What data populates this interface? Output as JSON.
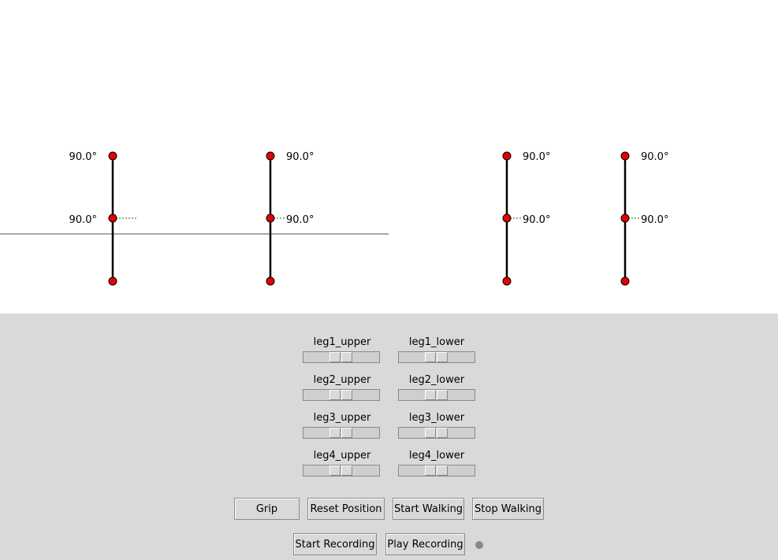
{
  "canvas": {
    "colors": {
      "joint": "#e60000",
      "leg": "#000000",
      "ground": "#555555",
      "marker": "#008000"
    },
    "legs": [
      {
        "upper_angle": "90.0°",
        "lower_angle": "90.0°"
      },
      {
        "upper_angle": "90.0°",
        "lower_angle": "90.0°"
      },
      {
        "upper_angle": "90.0°",
        "lower_angle": "90.0°"
      },
      {
        "upper_angle": "90.0°",
        "lower_angle": "90.0°"
      }
    ]
  },
  "sliders": [
    {
      "label": "leg1_upper",
      "value": 0.5
    },
    {
      "label": "leg1_lower",
      "value": 0.5
    },
    {
      "label": "leg2_upper",
      "value": 0.5
    },
    {
      "label": "leg2_lower",
      "value": 0.5
    },
    {
      "label": "leg3_upper",
      "value": 0.5
    },
    {
      "label": "leg3_lower",
      "value": 0.5
    },
    {
      "label": "leg4_upper",
      "value": 0.5
    },
    {
      "label": "leg4_lower",
      "value": 0.5
    }
  ],
  "buttons": {
    "grip": "Grip",
    "reset": "Reset Position",
    "start_walking": "Start Walking",
    "stop_walking": "Stop Walking",
    "start_recording": "Start Recording",
    "play_recording": "Play Recording"
  },
  "recording_indicator": {
    "color": "#888888"
  }
}
